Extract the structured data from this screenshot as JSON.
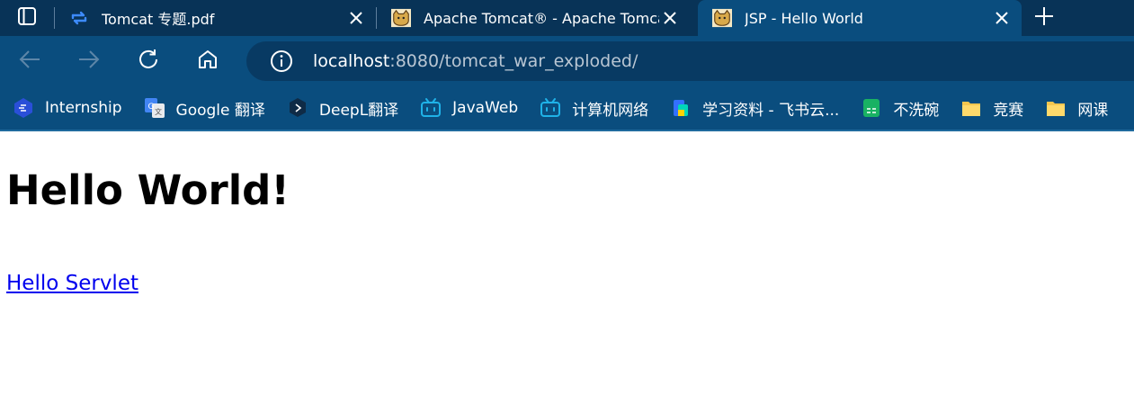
{
  "tabs": [
    {
      "title": "Tomcat 专题.pdf",
      "icon": "pdf-sync-icon",
      "active": false
    },
    {
      "title": "Apache Tomcat® - Apache Tomcat",
      "icon": "tomcat-icon",
      "active": false
    },
    {
      "title": "JSP - Hello World",
      "icon": "tomcat-icon",
      "active": true
    }
  ],
  "address": {
    "host": "localhost",
    "path": ":8080/tomcat_war_exploded/"
  },
  "bookmarks": [
    {
      "label": "Internship",
      "icon": "internship-icon"
    },
    {
      "label": "Google 翻译",
      "icon": "google-translate-icon"
    },
    {
      "label": "DeepL翻译",
      "icon": "deepl-icon"
    },
    {
      "label": "JavaWeb",
      "icon": "bilibili-icon"
    },
    {
      "label": "计算机网络",
      "icon": "bilibili-icon"
    },
    {
      "label": "学习资料 - 飞书云...",
      "icon": "feishu-icon"
    },
    {
      "label": "不洗碗",
      "icon": "sheet-icon"
    },
    {
      "label": "竞赛",
      "icon": "folder-icon"
    },
    {
      "label": "网课",
      "icon": "folder-icon"
    }
  ],
  "page": {
    "heading": "Hello World!",
    "link": "Hello Servlet"
  },
  "colors": {
    "accent": "#0a4d7e",
    "tabstrip": "#083357",
    "link": "#0000ee"
  }
}
